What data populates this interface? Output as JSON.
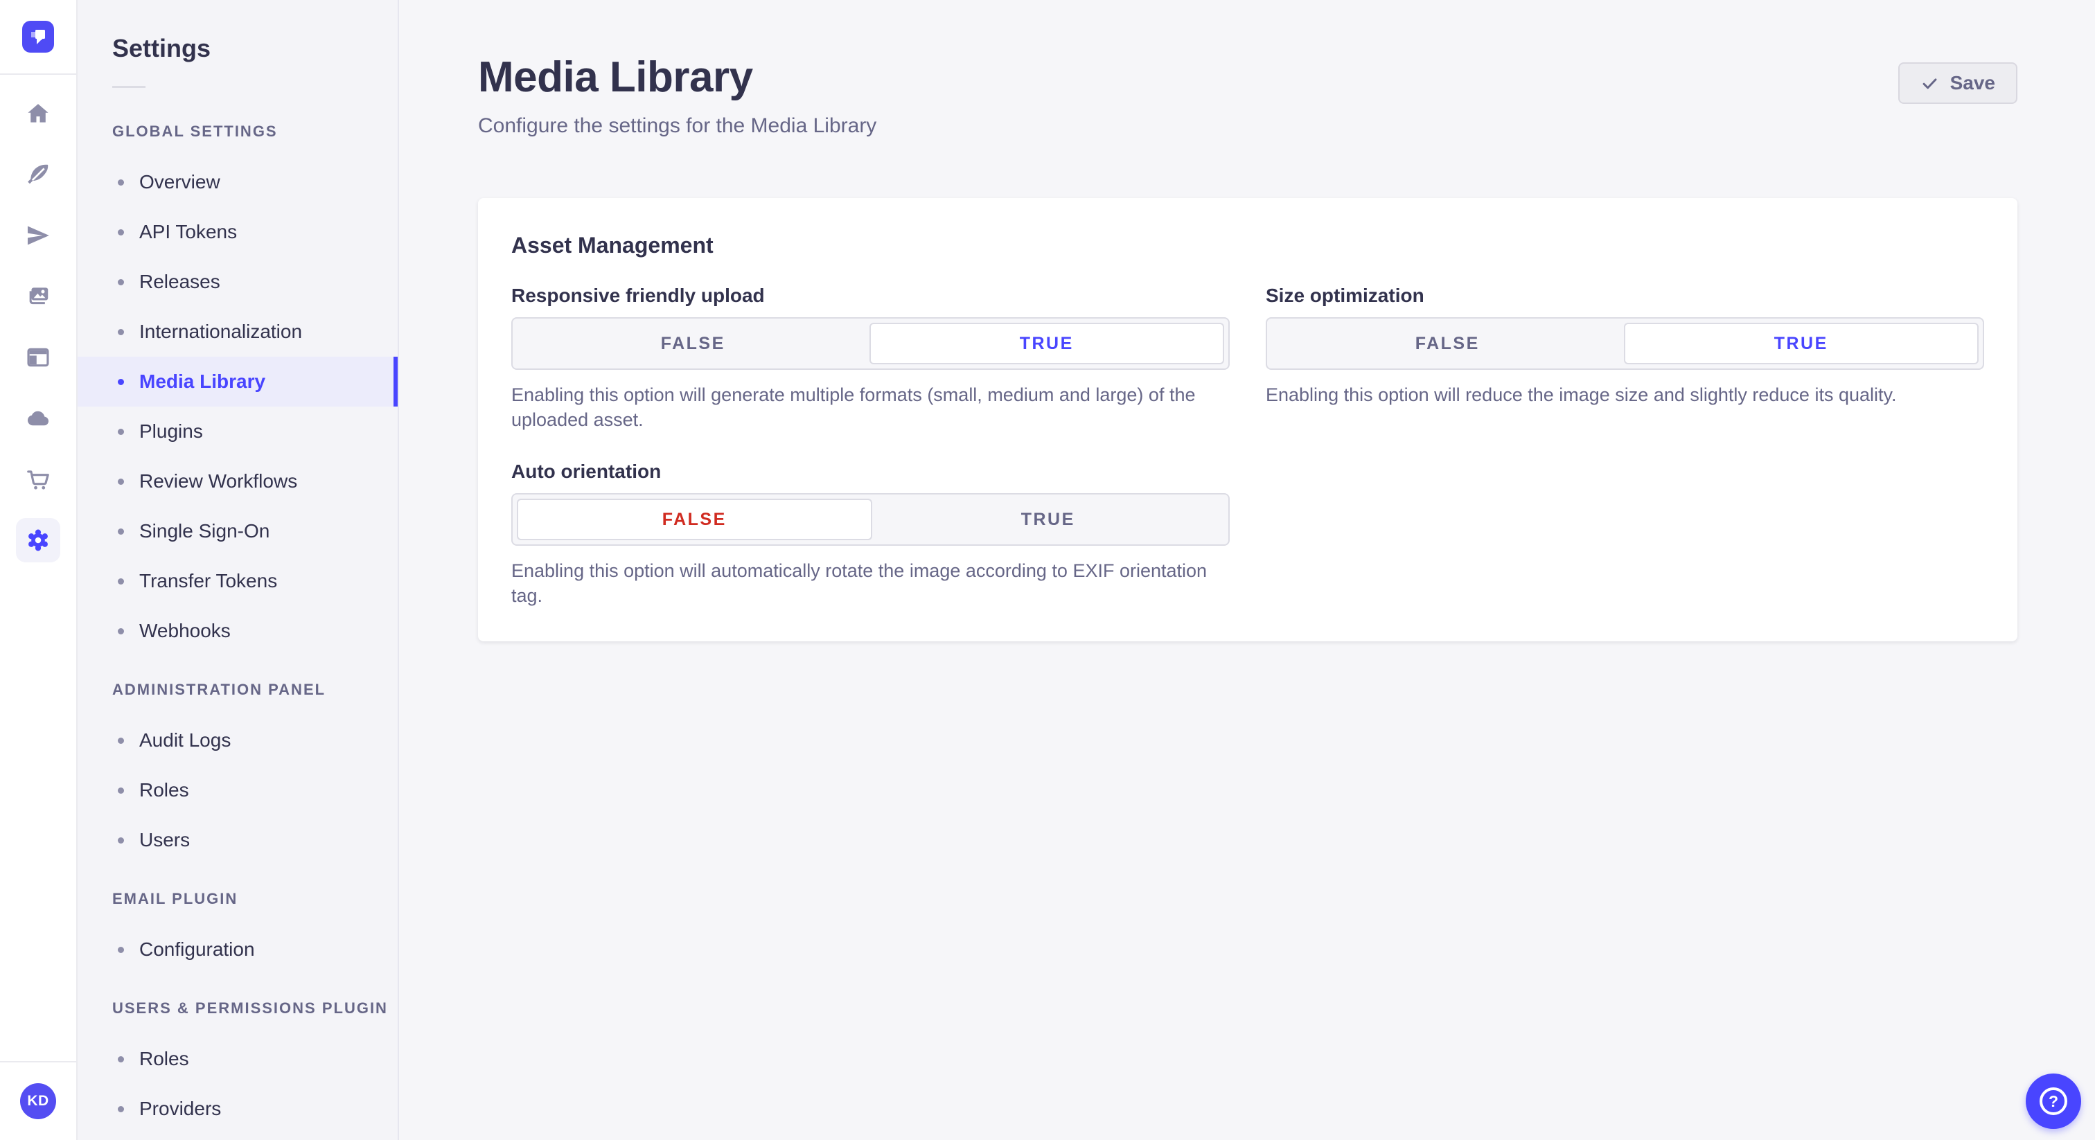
{
  "rail": {
    "logo_icon": "strapi-logo",
    "nav_icons": [
      "home-icon",
      "feather-icon",
      "paper-plane-icon",
      "media-pictures-icon",
      "layout-icon",
      "cloud-icon",
      "cart-icon",
      "settings-gear-icon"
    ],
    "active_icon": "settings-gear-icon",
    "user_initials": "KD"
  },
  "sidebar": {
    "title": "Settings",
    "sections": [
      {
        "label": "GLOBAL SETTINGS",
        "items": [
          {
            "label": "Overview",
            "active": false
          },
          {
            "label": "API Tokens",
            "active": false
          },
          {
            "label": "Releases",
            "active": false
          },
          {
            "label": "Internationalization",
            "active": false
          },
          {
            "label": "Media Library",
            "active": true
          },
          {
            "label": "Plugins",
            "active": false
          },
          {
            "label": "Review Workflows",
            "active": false
          },
          {
            "label": "Single Sign-On",
            "active": false
          },
          {
            "label": "Transfer Tokens",
            "active": false
          },
          {
            "label": "Webhooks",
            "active": false
          }
        ]
      },
      {
        "label": "ADMINISTRATION PANEL",
        "items": [
          {
            "label": "Audit Logs",
            "active": false
          },
          {
            "label": "Roles",
            "active": false
          },
          {
            "label": "Users",
            "active": false
          }
        ]
      },
      {
        "label": "EMAIL PLUGIN",
        "items": [
          {
            "label": "Configuration",
            "active": false
          }
        ]
      },
      {
        "label": "USERS & PERMISSIONS PLUGIN",
        "items": [
          {
            "label": "Roles",
            "active": false
          },
          {
            "label": "Providers",
            "active": false
          }
        ]
      }
    ]
  },
  "header": {
    "title": "Media Library",
    "subtitle": "Configure the settings for the Media Library",
    "save_label": "Save",
    "save_icon": "check-icon"
  },
  "card": {
    "title": "Asset Management",
    "fields": [
      {
        "label": "Responsive friendly upload",
        "options": [
          "FALSE",
          "TRUE"
        ],
        "value": "TRUE",
        "hint": "Enabling this option will generate multiple formats (small, medium and large) of the uploaded asset."
      },
      {
        "label": "Size optimization",
        "options": [
          "FALSE",
          "TRUE"
        ],
        "value": "TRUE",
        "hint": "Enabling this option will reduce the image size and slightly reduce its quality."
      },
      {
        "label": "Auto orientation",
        "options": [
          "FALSE",
          "TRUE"
        ],
        "value": "FALSE",
        "hint": "Enabling this option will automatically rotate the image according to EXIF orientation tag."
      }
    ]
  },
  "fab": {
    "icon": "question-mark-icon",
    "glyph": "?"
  },
  "colors": {
    "primary": "#4945ff",
    "primary_highlight": "#ececfb",
    "danger": "#d02b20",
    "text_dark": "#32324d",
    "text_muted": "#666687",
    "border": "#dcdce4",
    "background": "#f6f6f9"
  }
}
